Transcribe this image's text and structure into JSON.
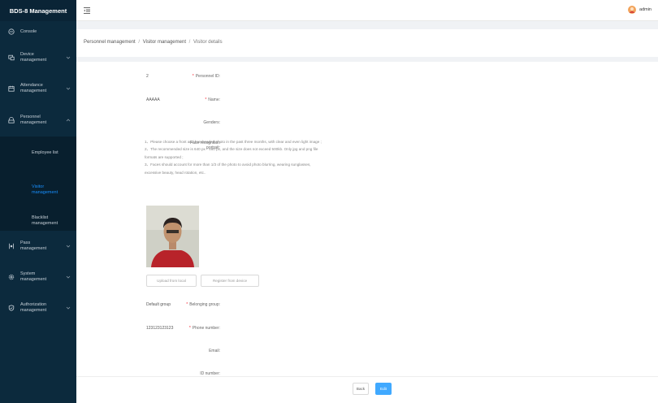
{
  "app": {
    "title": "BDS-8 Management"
  },
  "sidebar": {
    "items": [
      {
        "label": "Console",
        "icon": "dashboard-icon"
      },
      {
        "label": "Device\nmanagement",
        "icon": "device-icon"
      },
      {
        "label": "Attendance\nmanagement",
        "icon": "calendar-icon"
      },
      {
        "label": "Personnel\nmanagement",
        "icon": "personnel-icon",
        "expanded": true,
        "children": [
          {
            "label": "Employee list"
          },
          {
            "label": "Visitor\nmanagement",
            "active": true
          },
          {
            "label": "Blacklist\nmanagement"
          }
        ]
      },
      {
        "label": "Pass\nmanagement",
        "icon": "pass-icon"
      },
      {
        "label": "System\nmanagement",
        "icon": "system-icon"
      },
      {
        "label": "Authorization\nmanagement",
        "icon": "authorization-icon"
      }
    ]
  },
  "header": {
    "user": "admin"
  },
  "breadcrumb": {
    "items": [
      "Personnel management",
      "Visitor management",
      "Visitor details"
    ],
    "separator": "/"
  },
  "form": {
    "personnel_id": {
      "label": "Personnel ID:",
      "value": "2"
    },
    "name": {
      "label": "Name:",
      "value": "AAAAA"
    },
    "genders": {
      "label": "Genders:",
      "value": ""
    },
    "face_photo": {
      "label": "Face recognition\nportrait:",
      "notes": [
        "1、Please choose a front and bareheaded photo in the past three months, with clear and even light image ;",
        "2、The recommended size is 640 px * 480 px, and the size does not exceed 500kb. Only jpg and png file formats are supported ;",
        "3、Faces should account for more than 1/3 of the photo to avoid photo blurring, wearing sunglasses, excessive beauty, head rotation, etc.."
      ],
      "upload_local": "Upload from local",
      "register_device": "Register from device"
    },
    "belonging_group": {
      "label": "Belonging group:",
      "value": "Default group"
    },
    "phone_number": {
      "label": "Phone number:",
      "value": "123123123123"
    },
    "email": {
      "label": "Email:",
      "value": ""
    },
    "id_number": {
      "label": "ID number:",
      "value": ""
    }
  },
  "actions": {
    "back": "Back",
    "edit": "Edit"
  },
  "colors": {
    "sidebar_bg": "#0c2a3d",
    "accent": "#1890ff",
    "required": "#f5222d"
  }
}
